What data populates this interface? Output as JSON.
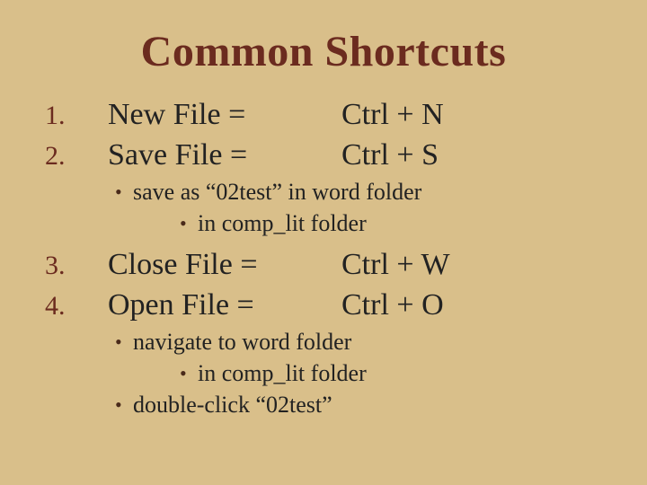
{
  "title": "Common Shortcuts",
  "list": {
    "i1": {
      "num": "1.",
      "label": "New File =",
      "key": "Ctrl + N"
    },
    "i2": {
      "num": "2.",
      "label": "Save File =",
      "key": "Ctrl + S"
    },
    "i2_sub1": "save as “02test” in word folder",
    "i2_sub1a": "in comp_lit folder",
    "i3": {
      "num": "3.",
      "label": "Close File =",
      "key": "Ctrl + W"
    },
    "i4": {
      "num": "4.",
      "label": "Open File =",
      "key": "Ctrl + O"
    },
    "i4_sub1": "navigate to word folder",
    "i4_sub1a": "in comp_lit folder",
    "i4_sub2": "double-click “02test”"
  }
}
